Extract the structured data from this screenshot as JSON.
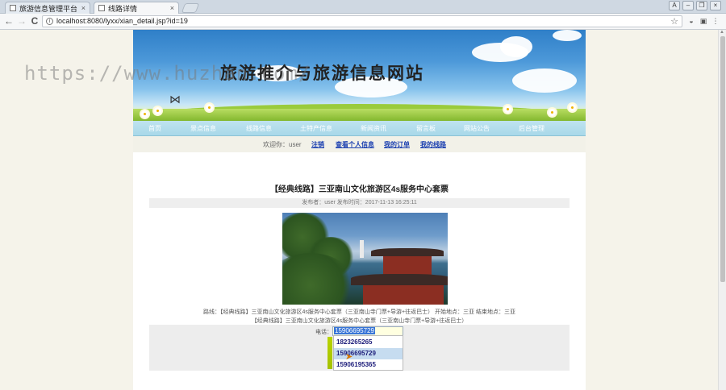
{
  "browser": {
    "tabs": [
      {
        "title": "旅游信息管理平台",
        "close": "×"
      },
      {
        "title": "线路详情",
        "close": "×"
      }
    ],
    "window_controls": [
      "A",
      "–",
      "❐",
      "×"
    ],
    "back": "←",
    "forward": "→",
    "reload": "C",
    "url": "localhost:8080/lyxx/xian_detail.jsp?id=19"
  },
  "site": {
    "title": "旅游推介与旅游信息网站",
    "nav": [
      "首页",
      "景点信息",
      "线路信息",
      "土特产信息",
      "新闻资讯",
      "留言板",
      "网站公告",
      "后台管理"
    ],
    "user_label": "欢迎你：user",
    "user_links": [
      "注销",
      "查看个人信息",
      "我的订单",
      "我的线路"
    ]
  },
  "article": {
    "title": "【经典线路】三亚南山文化旅游区4s服务中心套票",
    "meta": "发布者：user    发布时间：2017-11-13 16:25:11",
    "route_line1": "路线：【经典线路】三亚南山文化旅游区4s服务中心套票（三亚南山寺门票+导游+往返巴士）    开始地点：三亚    结束地点：三亚",
    "route_line2": "【经典线路】三亚南山文化旅游区4s服务中心套票（三亚南山寺门票+导游+往返巴士）"
  },
  "phone": {
    "label": "电话：",
    "value": "15906695729",
    "suggestions": [
      "1823265265",
      "15906695729",
      "15906195365"
    ],
    "selected_index": 1
  },
  "watermark": "https://www.huzhan.com/",
  "colors": {
    "nav_bg": "#a8d8e9",
    "link": "#1a3fb0",
    "selection": "#3875d7"
  }
}
